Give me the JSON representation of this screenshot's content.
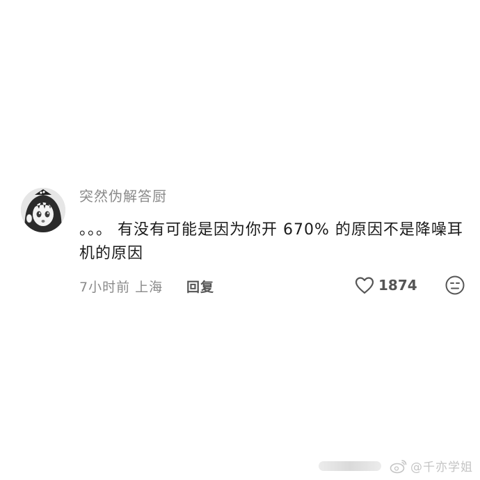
{
  "comment": {
    "username": "突然伪解答厨",
    "text": "。。。 有没有可能是因为你开 670% 的原因不是降噪耳机的原因",
    "time_location": "7小时前 上海",
    "reply_label": "回复",
    "like_count": "1874",
    "avatar_icon": "anime-avatar",
    "like_icon": "heart-outline-icon",
    "emoji_icon": "neutral-face-icon"
  },
  "watermark": {
    "text": "@千亦学姐",
    "icon": "weibo-logo"
  },
  "colors": {
    "username": "#8a8a8a",
    "text": "#1a1a1a",
    "meta": "#8a8a8a",
    "watermark": "#c4c4c4"
  }
}
